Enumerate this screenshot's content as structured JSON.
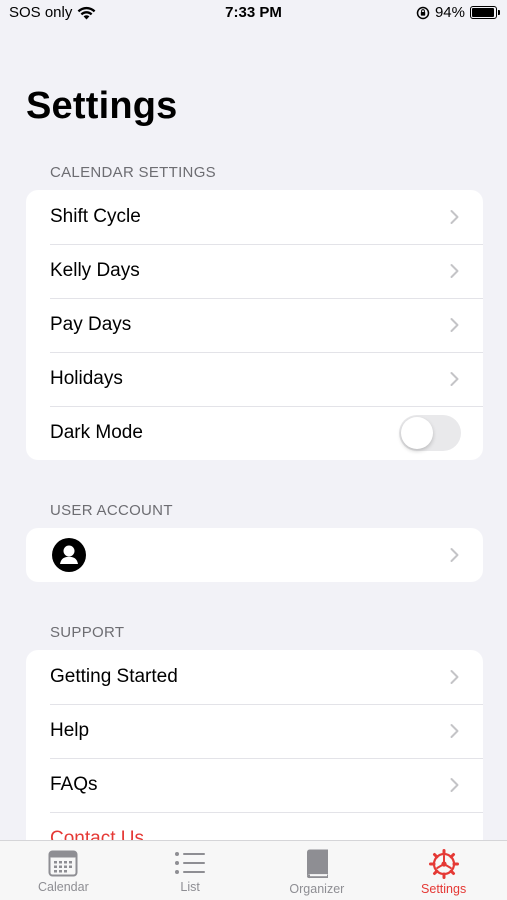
{
  "status_bar": {
    "carrier": "SOS only",
    "time": "7:33 PM",
    "battery_percent": "94%",
    "battery_level": 0.94
  },
  "page": {
    "title": "Settings"
  },
  "sections": {
    "calendar": {
      "header": "CALENDAR SETTINGS",
      "items": [
        {
          "label": "Shift Cycle"
        },
        {
          "label": "Kelly Days"
        },
        {
          "label": "Pay Days"
        },
        {
          "label": "Holidays"
        },
        {
          "label": "Dark Mode",
          "toggle_on": false
        }
      ]
    },
    "account": {
      "header": "USER ACCOUNT",
      "icon": "person-circle-icon"
    },
    "support": {
      "header": "SUPPORT",
      "items": [
        {
          "label": "Getting Started"
        },
        {
          "label": "Help"
        },
        {
          "label": "FAQs"
        },
        {
          "label": "Contact Us"
        }
      ]
    }
  },
  "tab_bar": {
    "tabs": [
      {
        "label": "Calendar",
        "icon": "calendar-icon"
      },
      {
        "label": "List",
        "icon": "list-icon"
      },
      {
        "label": "Organizer",
        "icon": "book-icon"
      },
      {
        "label": "Settings",
        "icon": "gear-icon",
        "active": true
      }
    ]
  },
  "colors": {
    "accent": "#e53935",
    "background": "#f2f2f7",
    "secondary_text": "#6d6d72",
    "inactive_tab": "#8e8e93"
  }
}
